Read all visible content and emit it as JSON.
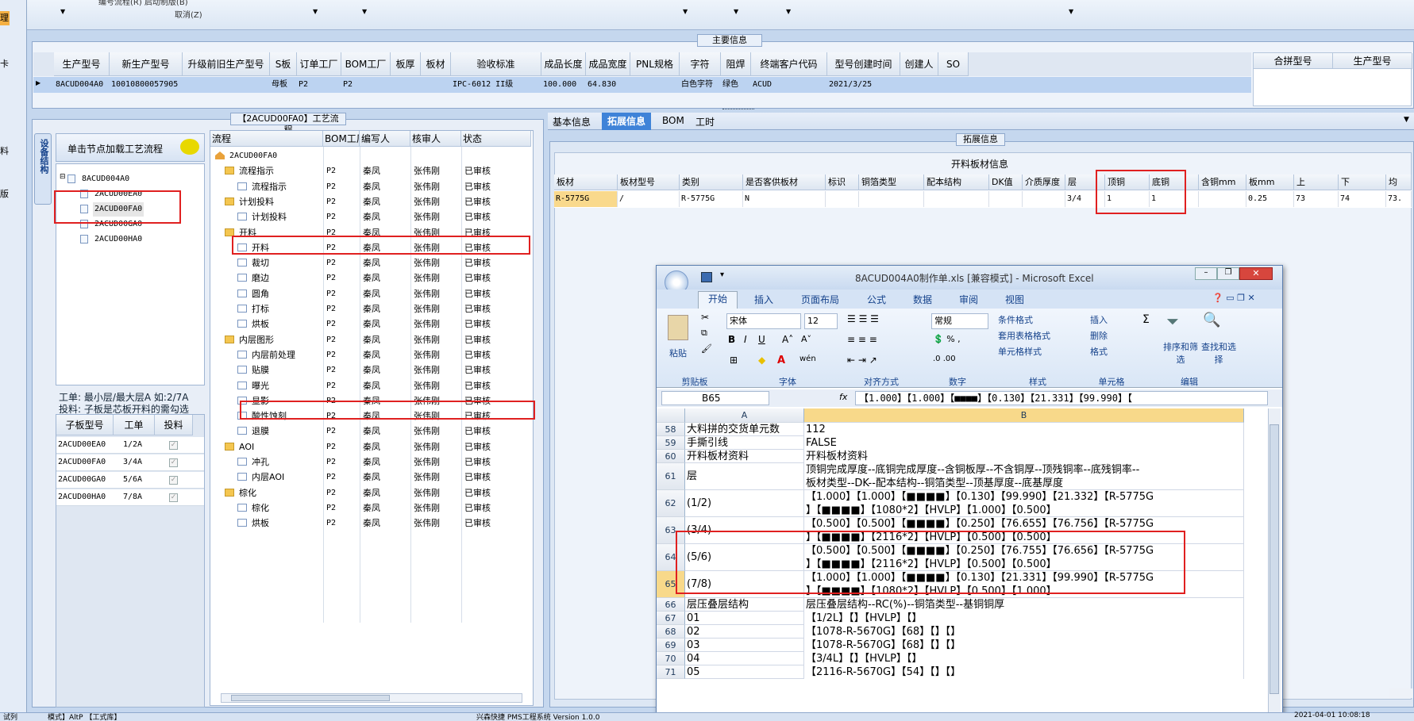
{
  "top": {
    "menu1": "编号流程(R)  启动制版(B)",
    "menu2": "取消(Z)"
  },
  "left_strip": [
    "理",
    "卡",
    "料",
    "版"
  ],
  "main_info": {
    "title": "主要信息",
    "headers": [
      "生产型号",
      "新生产型号",
      "升级前旧生产型号",
      "S板",
      "订单工厂",
      "BOM工厂",
      "板厚",
      "板材",
      "验收标准",
      "成品长度",
      "成品宽度",
      "PNL规格",
      "字符",
      "阻焊",
      "终端客户代码",
      "型号创建时间",
      "创建人",
      "SO"
    ],
    "row": [
      "8ACUD004A0",
      "10010800057905",
      "",
      "母板",
      "P2",
      "P2",
      "",
      "",
      "IPC-6012 II级",
      "100.000",
      "64.830",
      "",
      "白色字符",
      "绿色",
      "ACUD",
      "2021/3/25",
      "",
      ""
    ],
    "right_headers": [
      "合拼型号",
      "生产型号"
    ]
  },
  "process": {
    "title": "【2ACUD00FA0】工艺流程",
    "side_tab": "设备结构",
    "hint": "单击节点加载工艺流程",
    "tree": [
      "8ACUD004A0",
      "2ACUD00EA0",
      "2ACUD00FA0",
      "2ACUD00GA0",
      "2ACUD00HA0"
    ],
    "work_note1": "工单: 最小层/最大层A 如:2/7A",
    "work_note2": "投料: 子板是芯板开料的需勾选",
    "sub_headers": [
      "子板型号",
      "工单",
      "投料"
    ],
    "sub_rows": [
      [
        "2ACUD00EA0",
        "1/2A"
      ],
      [
        "2ACUD00FA0",
        "3/4A"
      ],
      [
        "2ACUD00GA0",
        "5/6A"
      ],
      [
        "2ACUD00HA0",
        "7/8A"
      ]
    ],
    "flow_headers": [
      "流程",
      "BOM工厂",
      "编写人",
      "核审人",
      "状态"
    ],
    "root": "2ACUD00FA0",
    "flow": [
      {
        "name": "流程指示",
        "lvl": 1,
        "folder": true
      },
      {
        "name": "流程指示",
        "lvl": 2
      },
      {
        "name": "计划投料",
        "lvl": 1,
        "folder": true
      },
      {
        "name": "计划投料",
        "lvl": 2
      },
      {
        "name": "开料",
        "lvl": 1,
        "folder": true
      },
      {
        "name": "开料",
        "lvl": 2
      },
      {
        "name": "裁切",
        "lvl": 2
      },
      {
        "name": "磨边",
        "lvl": 2
      },
      {
        "name": "圆角",
        "lvl": 2
      },
      {
        "name": "打标",
        "lvl": 2
      },
      {
        "name": "烘板",
        "lvl": 2
      },
      {
        "name": "内层图形",
        "lvl": 1,
        "folder": true
      },
      {
        "name": "内层前处理",
        "lvl": 2
      },
      {
        "name": "贴膜",
        "lvl": 2
      },
      {
        "name": "曝光",
        "lvl": 2
      },
      {
        "name": "显影",
        "lvl": 2
      },
      {
        "name": "酸性蚀刻",
        "lvl": 2
      },
      {
        "name": "退膜",
        "lvl": 2
      },
      {
        "name": "AOI",
        "lvl": 1,
        "folder": true
      },
      {
        "name": "冲孔",
        "lvl": 2
      },
      {
        "name": "内层AOI",
        "lvl": 2
      },
      {
        "name": "棕化",
        "lvl": 1,
        "folder": true
      },
      {
        "name": "棕化",
        "lvl": 2
      },
      {
        "name": "烘板",
        "lvl": 2
      }
    ],
    "bom": "P2",
    "writer": "秦凤",
    "checker": "张伟刚",
    "status": "已审核"
  },
  "right": {
    "tabs": [
      "基本信息",
      "拓展信息",
      "BOM",
      "工时"
    ],
    "ext_title": "拓展信息",
    "table_title": "开料板材信息",
    "headers": [
      "板材",
      "板材型号",
      "类别",
      "是否客供板材",
      "标识",
      "铜箔类型",
      "配本结构",
      "DK值",
      "介质厚度",
      "层",
      "顶铜",
      "底铜",
      "含铜mm",
      "板mm",
      "上",
      "下",
      "均"
    ],
    "row": [
      "R-5775G",
      "/",
      "R-5775G",
      "N",
      "",
      "",
      "",
      "",
      "",
      "3/4",
      "1",
      "1",
      "",
      "0.25",
      "73",
      "74",
      "73."
    ]
  },
  "excel": {
    "title": "8ACUD004A0制作单.xls [兼容模式] - Microsoft Excel",
    "tabs": [
      "开始",
      "插入",
      "页面布局",
      "公式",
      "数据",
      "审阅",
      "视图"
    ],
    "font": "宋体",
    "size": "12",
    "numfmt": "常规",
    "groups": [
      "剪贴板",
      "字体",
      "对齐方式",
      "数字",
      "样式",
      "单元格",
      "编辑"
    ],
    "paste": "粘贴",
    "style_items": [
      "条件格式",
      "套用表格格式",
      "单元格样式"
    ],
    "cell_items": [
      "插入",
      "删除",
      "格式"
    ],
    "edit_items": [
      "排序和筛选",
      "查找和选择"
    ],
    "namebox": "B65",
    "formula": "【1.000】【1.000】【■■■■】【0.130】【21.331】【99.990】【",
    "cols": [
      "A",
      "B"
    ],
    "rows": [
      {
        "n": "58",
        "a": "大料拼的交货单元数",
        "b": "112"
      },
      {
        "n": "59",
        "a": "手撕引线",
        "b": "FALSE"
      },
      {
        "n": "60",
        "a": "开料板材资料",
        "b": "开料板材资料"
      },
      {
        "n": "61",
        "a": "层",
        "b": "顶铜完成厚度--底铜完成厚度--含铜板厚--不含铜厚--顶残铜率--底残铜率--",
        "b2": "板材类型--DK--配本结构--铜箔类型--顶基厚度--底基厚度"
      },
      {
        "n": "62",
        "a": "(1/2)",
        "b": "【1.000】【1.000】【■■■■】【0.130】【99.990】【21.332】【R-5775G",
        "b2": "】【■■■■】【1080*2】【HVLP】【1.000】【0.500】"
      },
      {
        "n": "63",
        "a": "(3/4)",
        "b": "【0.500】【0.500】【■■■■】【0.250】【76.655】【76.756】【R-5775G",
        "b2": "】【■■■■】【2116*2】【HVLP】【0.500】【0.500】"
      },
      {
        "n": "64",
        "a": "(5/6)",
        "b": "【0.500】【0.500】【■■■■】【0.250】【76.755】【76.656】【R-5775G",
        "b2": "】【■■■■】【2116*2】【HVLP】【0.500】【0.500】"
      },
      {
        "n": "65",
        "a": "(7/8)",
        "b": "【1.000】【1.000】【■■■■】【0.130】【21.331】【99.990】【R-5775G",
        "b2": "】【■■■■】【1080*2】【HVLP】【0.500】【1.000】"
      },
      {
        "n": "66",
        "a": "层压叠层结构",
        "b": "层压叠层结构--RC(%)--铜箔类型--基铜铜厚"
      },
      {
        "n": "67",
        "a": "01",
        "b": "【1/2L】【】【HVLP】【】"
      },
      {
        "n": "68",
        "a": "02",
        "b": "【1078-R-5670G】【68】【】【】"
      },
      {
        "n": "69",
        "a": "03",
        "b": "【1078-R-5670G】【68】【】【】"
      },
      {
        "n": "70",
        "a": "04",
        "b": "【3/4L】【】【HVLP】【】"
      },
      {
        "n": "71",
        "a": "05",
        "b": "【2116-R-5670G】【54】【】【】"
      }
    ]
  },
  "status": {
    "left": "试列",
    "mid": "模式】AltP 【工式库】",
    "right": "兴森快捷 PMS工程系统 Version 1.0.0",
    "time": "2021-04-01 10:08:18"
  }
}
